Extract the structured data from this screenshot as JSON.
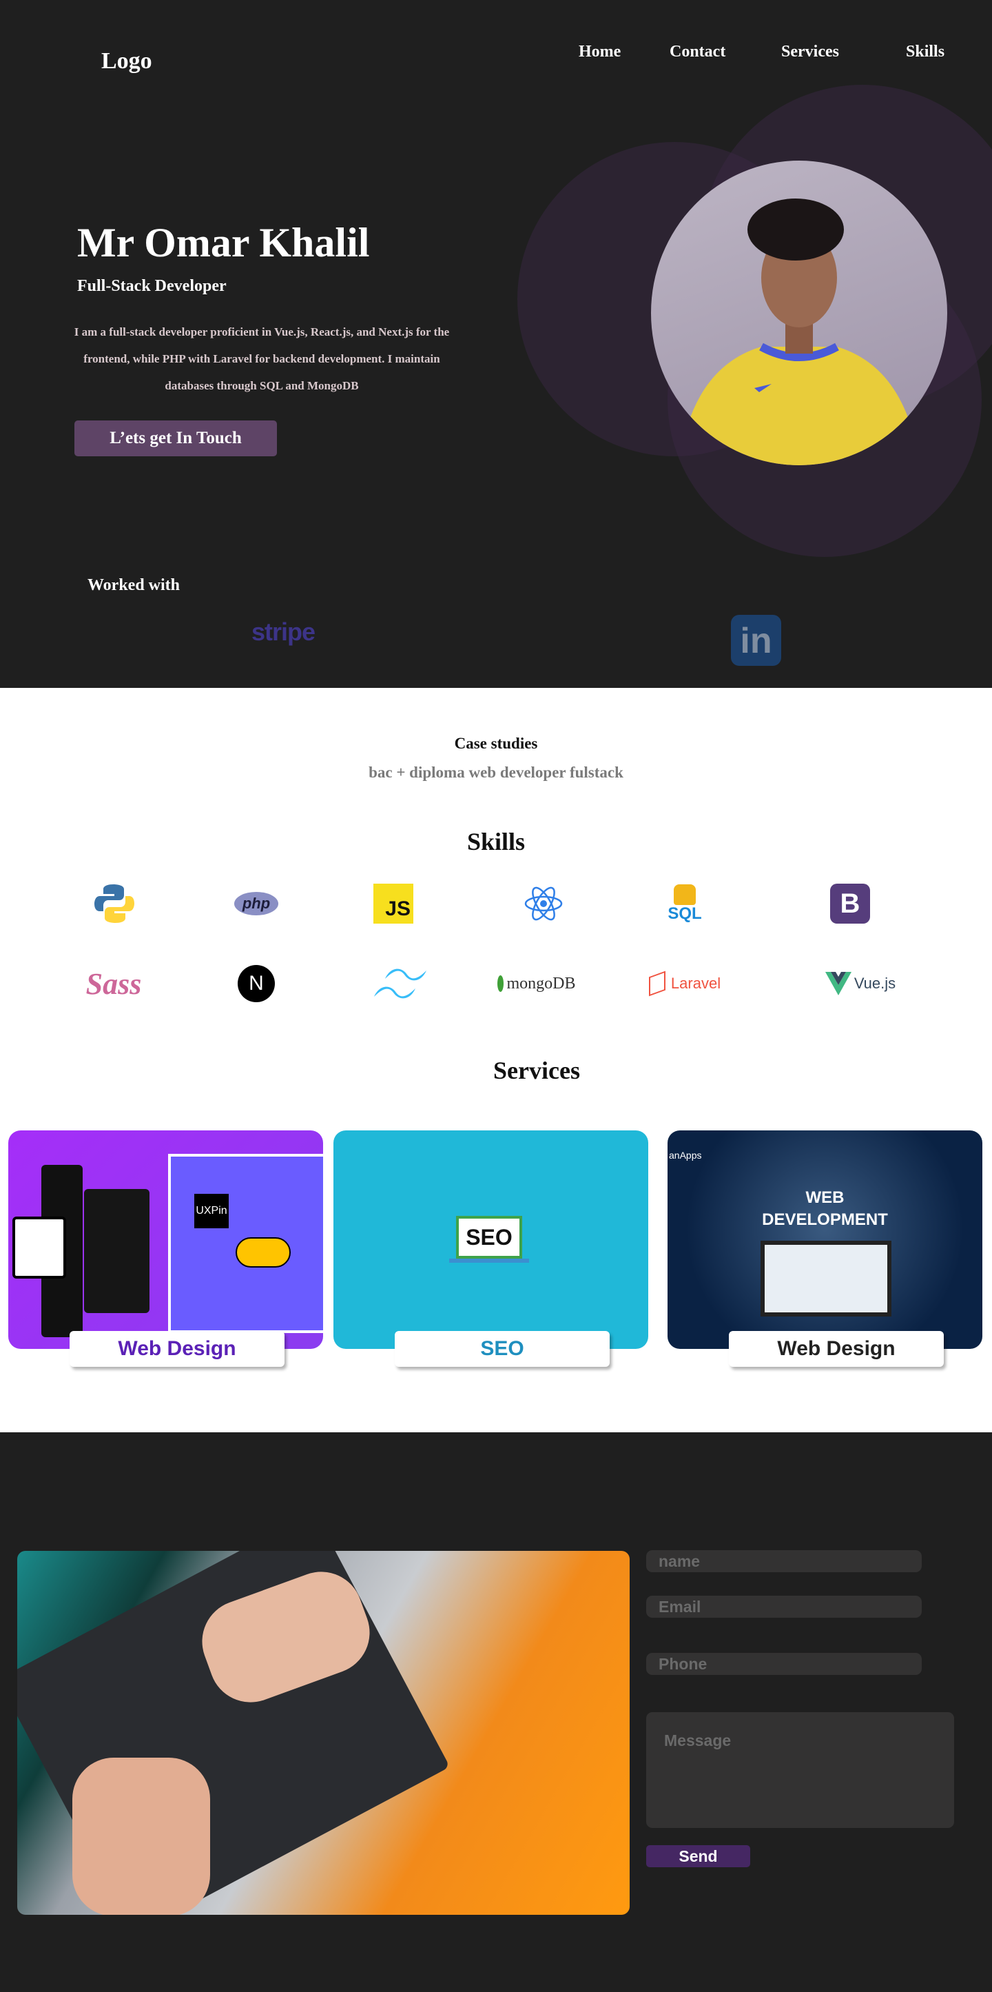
{
  "header": {
    "logo": "Logo",
    "nav": [
      "Home",
      "Contact",
      "Services",
      "Skills"
    ]
  },
  "hero": {
    "name": "Mr Omar Khalil",
    "role": "Full-Stack Developer",
    "bio": "I am a full-stack developer proficient in Vue.js, React.js, and Next.js for the frontend, while PHP with Laravel for backend development. I maintain databases through SQL and MongoDB",
    "cta": "L’ets get In Touch",
    "worked_with": "Worked with",
    "partners": [
      "stripe",
      "in"
    ]
  },
  "case_studies": {
    "title": "Case studies",
    "subtitle": "bac + diploma web developer fulstack"
  },
  "skills": {
    "title": "Skills",
    "items": [
      "php",
      "JS",
      "SQL",
      "B",
      "N",
      "mongoDB",
      "Laravel",
      "Vue.js"
    ]
  },
  "services": {
    "title": "Services",
    "cards": [
      {
        "label": "Web Design",
        "color": "#5b21b6"
      },
      {
        "label": "SEO",
        "color": "#1f8fbf",
        "badge": "SEO"
      },
      {
        "label": "Web Design",
        "color": "#222222",
        "line1": "WEB",
        "line2": "DEVELOPMENT",
        "corner": "anApps"
      }
    ],
    "uxpin": "UXPin"
  },
  "contact": {
    "name_placeholder": "name",
    "email_placeholder": "Email",
    "phone_placeholder": "Phone",
    "message_placeholder": "Message",
    "send": "Send"
  }
}
